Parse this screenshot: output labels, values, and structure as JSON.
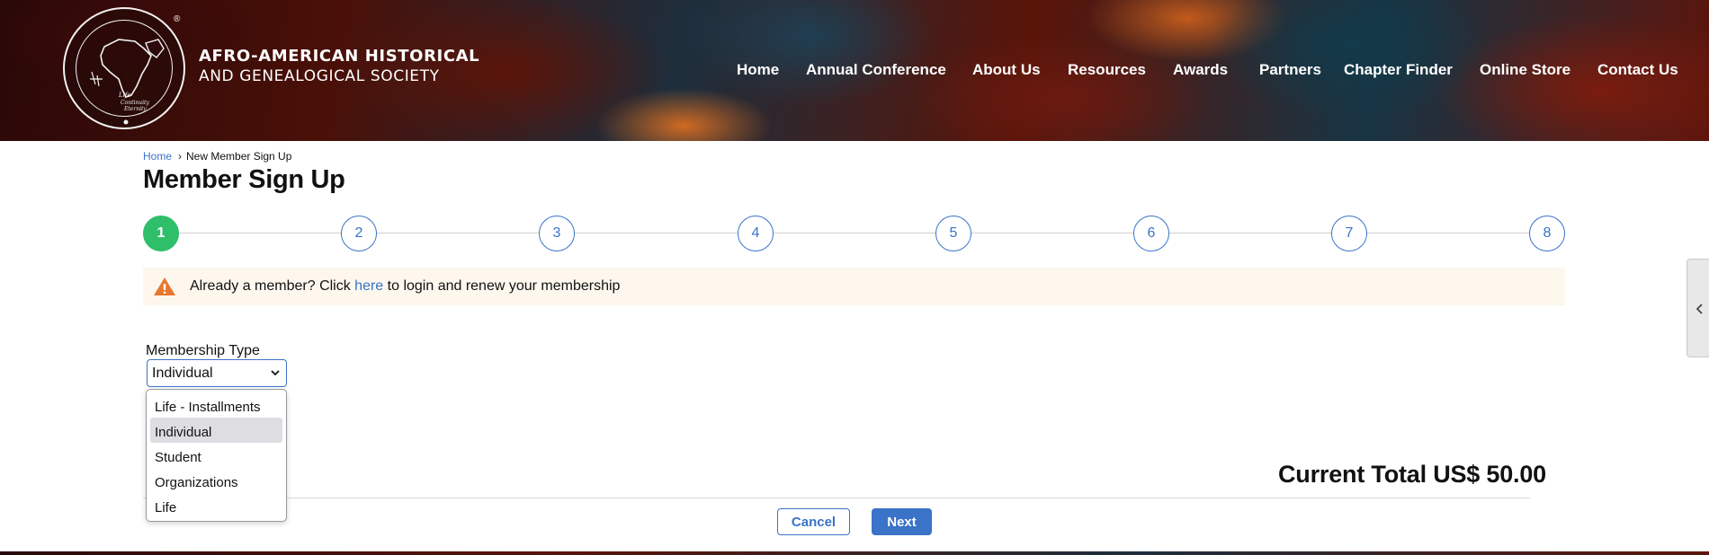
{
  "header": {
    "logo_line1": "AFRO-AMERICAN HISTORICAL",
    "logo_line2": "AND GENEALOGICAL SOCIETY",
    "registered_mark": "®",
    "seal_text": "AFRO-AMERICAN HISTORICAL AND GENEALOGICAL SOCIETY",
    "seal_motto": [
      "Life",
      "Continuity",
      "Eternity"
    ]
  },
  "nav": {
    "items": [
      "Home",
      "Annual Conference",
      "About Us",
      "Resources",
      "Awards",
      "Partners",
      "Chapter Finder",
      "Online Store",
      "Contact Us"
    ]
  },
  "breadcrumb": {
    "home": "Home",
    "separator": "›",
    "current": "New Member Sign Up"
  },
  "page": {
    "title": "Member Sign Up"
  },
  "stepper": {
    "steps": [
      "1",
      "2",
      "3",
      "4",
      "5",
      "6",
      "7",
      "8"
    ],
    "active_step": "1",
    "active_color": "#2fbf6a",
    "accent_color": "#3a73c8"
  },
  "alert": {
    "prefix": "Already a member? Click ",
    "link": "here",
    "suffix": " to login and renew your membership",
    "icon": "warning-icon",
    "icon_color": "#e8772e"
  },
  "form": {
    "membership_label": "Membership Type",
    "membership_value": "Individual",
    "options": [
      "Life - Installments",
      "Individual",
      "Student",
      "Organizations",
      "Life"
    ],
    "selected_option": "Individual"
  },
  "summary": {
    "total": "Current Total US$ 50.00"
  },
  "actions": {
    "cancel": "Cancel",
    "next": "Next"
  }
}
